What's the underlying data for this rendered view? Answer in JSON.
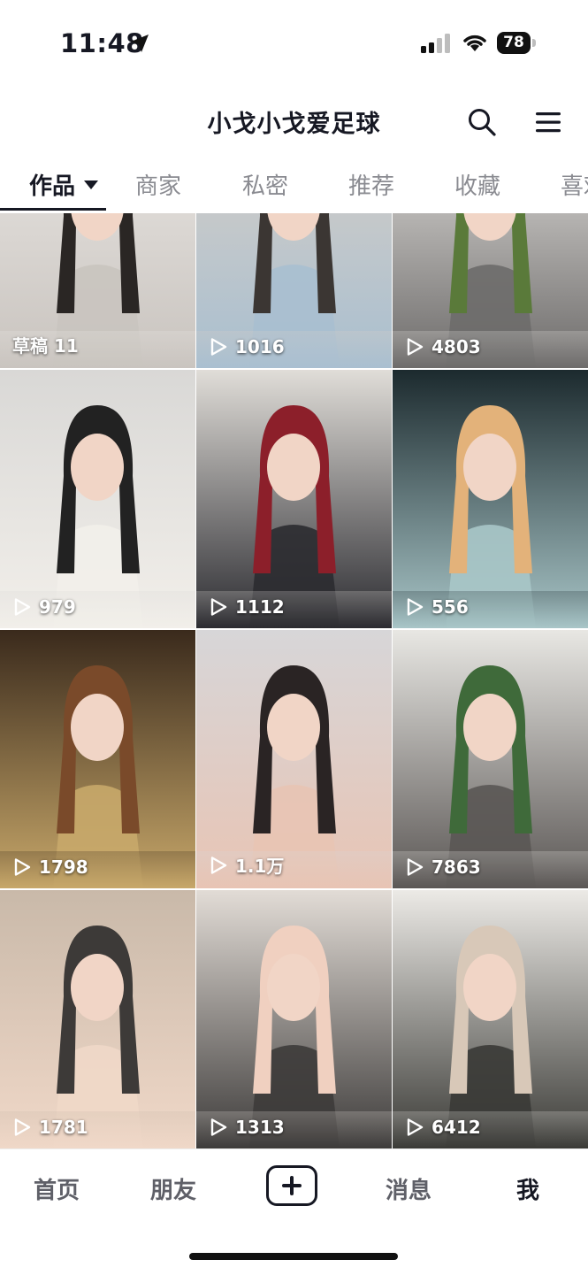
{
  "status": {
    "time": "11:48",
    "battery": "78"
  },
  "header": {
    "title": "小戈小戈爱足球"
  },
  "tabs": [
    {
      "label": "作品"
    },
    {
      "label": "商家"
    },
    {
      "label": "私密"
    },
    {
      "label": "推荐"
    },
    {
      "label": "收藏"
    },
    {
      "label": "喜欢"
    }
  ],
  "grid": [
    {
      "label": "草稿 11",
      "kind": "draft",
      "colors": [
        "#e9e6e3",
        "#c9c4bf",
        "#2a2624"
      ]
    },
    {
      "label": "1016",
      "kind": "play",
      "colors": [
        "#d8cfc6",
        "#a9bfd0",
        "#3b3633"
      ]
    },
    {
      "label": "4803",
      "kind": "play",
      "colors": [
        "#e7e5e2",
        "#6d6b6a",
        "#5a7a3a"
      ]
    },
    {
      "label": "979",
      "kind": "play",
      "colors": [
        "#d9d8d6",
        "#f2efea",
        "#222222"
      ]
    },
    {
      "label": "1112",
      "kind": "play",
      "colors": [
        "#e0ddd8",
        "#2b2b30",
        "#8c1f2a"
      ]
    },
    {
      "label": "556",
      "kind": "play",
      "colors": [
        "#1c2a2e",
        "#a9c6c8",
        "#e3b27a"
      ]
    },
    {
      "label": "1798",
      "kind": "play",
      "colors": [
        "#3a2a1c",
        "#c8a86a",
        "#7a4a2a"
      ]
    },
    {
      "label": "1.1万",
      "kind": "play",
      "colors": [
        "#d7d6d8",
        "#e8c4b4",
        "#2a2424"
      ]
    },
    {
      "label": "7863",
      "kind": "play",
      "colors": [
        "#e8e7e3",
        "#5a5654",
        "#3f6a3a"
      ]
    },
    {
      "label": "1781",
      "kind": "play",
      "colors": [
        "#c9b9a9",
        "#f0d8c8",
        "#3d3a38"
      ]
    },
    {
      "label": "1313",
      "kind": "play",
      "colors": [
        "#e2dcd6",
        "#3d3b3a",
        "#f0d0c0"
      ]
    },
    {
      "label": "6412",
      "kind": "play",
      "colors": [
        "#eceae6",
        "#3a3a36",
        "#d8c8b8"
      ]
    }
  ],
  "nav": {
    "home": "首页",
    "friends": "朋友",
    "messages": "消息",
    "me": "我"
  }
}
